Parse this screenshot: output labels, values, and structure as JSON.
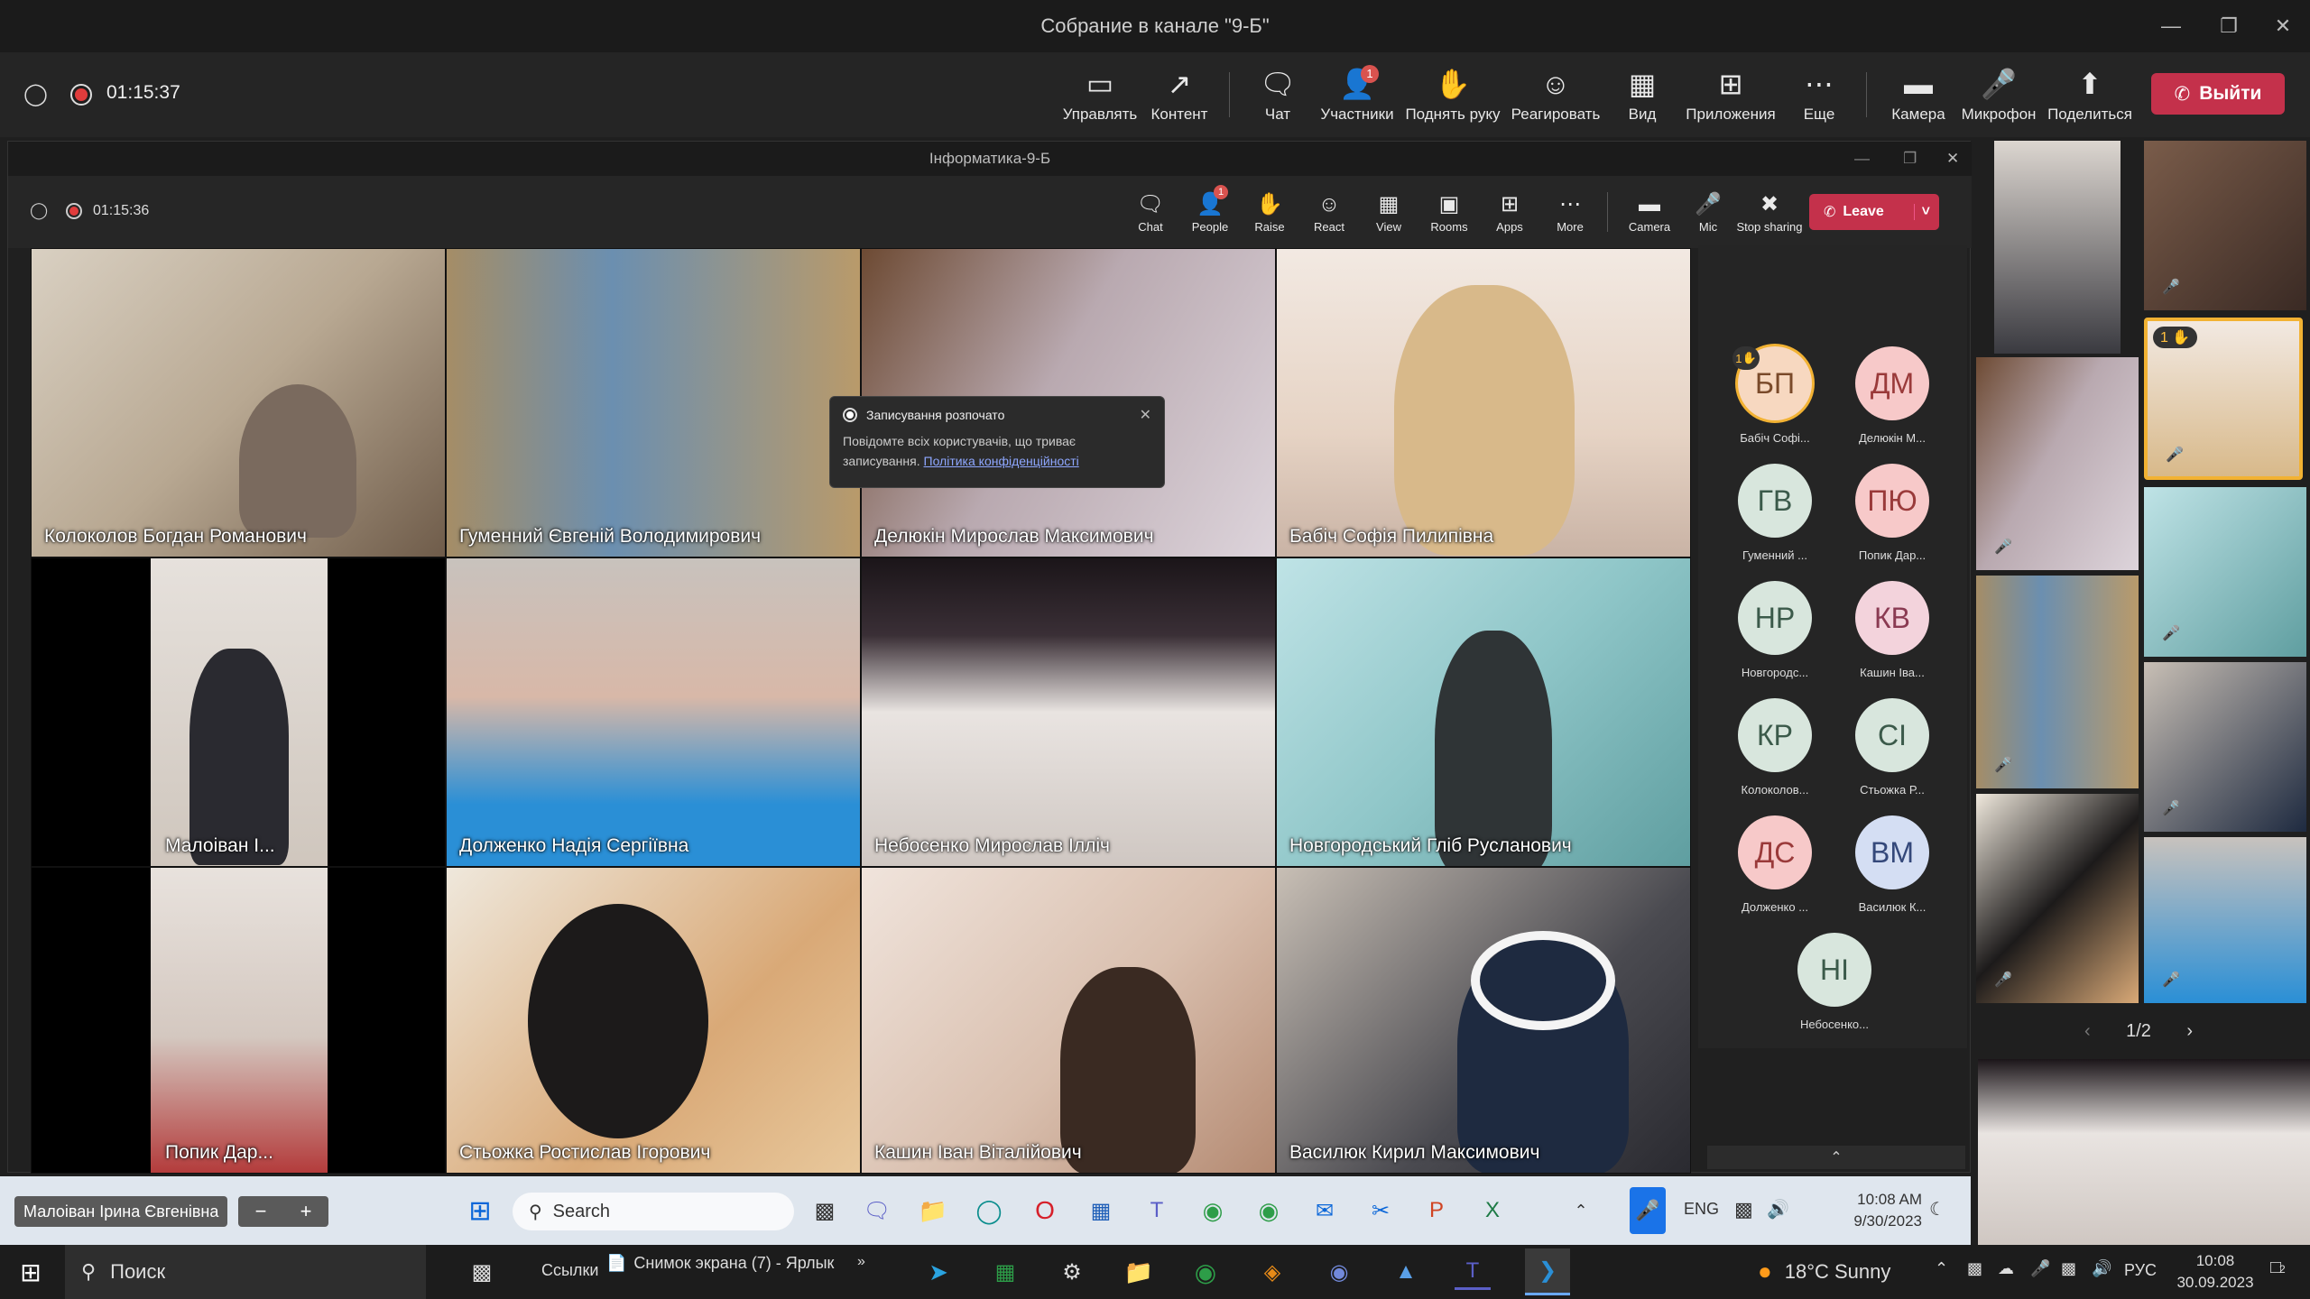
{
  "outer": {
    "window_title": "Собрание в канале \"9-Б\"",
    "timer": "01:15:37",
    "toolbar": [
      {
        "label": "Управлять",
        "icon": "share-screen-icon"
      },
      {
        "label": "Контент",
        "icon": "content-icon"
      },
      {
        "label": "Чат",
        "icon": "chat-icon"
      },
      {
        "label": "Участники",
        "icon": "people-icon",
        "badge": "1"
      },
      {
        "label": "Поднять руку",
        "icon": "raise-hand-icon"
      },
      {
        "label": "Реагировать",
        "icon": "react-icon"
      },
      {
        "label": "Вид",
        "icon": "view-icon"
      },
      {
        "label": "Приложения",
        "icon": "apps-icon"
      },
      {
        "label": "Еще",
        "icon": "more-icon"
      },
      {
        "label": "Камера",
        "icon": "camera-icon"
      },
      {
        "label": "Микрофон",
        "icon": "mic-off-icon"
      },
      {
        "label": "Поделиться",
        "icon": "share-icon"
      }
    ],
    "leave_label": "Выйти"
  },
  "inner": {
    "window_title": "Інформатика-9-Б",
    "timer": "01:15:36",
    "toolbar": [
      {
        "label": "Chat"
      },
      {
        "label": "People",
        "badge": "1"
      },
      {
        "label": "Raise"
      },
      {
        "label": "React"
      },
      {
        "label": "View"
      },
      {
        "label": "Rooms"
      },
      {
        "label": "Apps"
      },
      {
        "label": "More"
      },
      {
        "label": "Camera"
      },
      {
        "label": "Mic"
      },
      {
        "label": "Stop sharing"
      }
    ],
    "leave_label": "Leave",
    "notification": {
      "title": "Записування розпочато",
      "body": "Повідомте всіх користувачів, що триває записування.",
      "link": "Політика конфіденційності"
    },
    "tiles": [
      "Колоколов Богдан Романович",
      "Гуменний Євгеній Володимирович",
      "Делюкін Мирослав Максимович",
      "Бабіч Софія Пилипівна",
      "Малоіван І...",
      "Долженко Надія Сергіївна",
      "Небосенко Мирослав Ілліч",
      "Новгородський Гліб Русланович",
      "Попик Дар...",
      "Стьожка Ростислав Ігорович",
      "Кашин Іван Віталійович",
      "Василюк Кирил Максимович"
    ],
    "roster": [
      {
        "initials": "БП",
        "name": "Бабіч Софі...",
        "color": "#f7d8c0",
        "text": "#7a4a2a",
        "hand": "1"
      },
      {
        "initials": "ДМ",
        "name": "Делюкін М...",
        "color": "#f7c9c9",
        "text": "#9a3a3a"
      },
      {
        "initials": "ГВ",
        "name": "Гуменний ...",
        "color": "#d8e6dd",
        "text": "#3b5a4a"
      },
      {
        "initials": "ПЮ",
        "name": "Попик Дар...",
        "color": "#f7c9c9",
        "text": "#9a3a3a"
      },
      {
        "initials": "НР",
        "name": "Новгородс...",
        "color": "#d8e6dd",
        "text": "#3b5a4a"
      },
      {
        "initials": "КВ",
        "name": "Кашин Іва...",
        "color": "#f3d3dc",
        "text": "#8a3a52"
      },
      {
        "initials": "КР",
        "name": "Колоколов...",
        "color": "#d8e6dd",
        "text": "#3b5a4a"
      },
      {
        "initials": "СІ",
        "name": "Стьожка Р...",
        "color": "#d8e6dd",
        "text": "#3b5a4a"
      },
      {
        "initials": "ДС",
        "name": "Долженко ...",
        "color": "#f7c9c9",
        "text": "#9a3a3a"
      },
      {
        "initials": "ВМ",
        "name": "Василюк К...",
        "color": "#d4def3",
        "text": "#34487a"
      },
      {
        "initials": "НІ",
        "name": "Небосенко...",
        "color": "#d8e6dd",
        "text": "#3b5a4a"
      }
    ]
  },
  "right_strip": {
    "hand_badge": "1",
    "pager": "1/2"
  },
  "taskbar_inner": {
    "presenter": "Малоіван Ірина Євгенівна",
    "search": "Search",
    "lang": "ENG",
    "time": "10:08 AM",
    "date": "9/30/2023"
  },
  "taskbar_outer": {
    "search": "Поиск",
    "links": "Ссылки",
    "shortcut": "Снимок экрана (7) - Ярлык",
    "weather": "18°C  Sunny",
    "lang": "РУС",
    "time": "10:08",
    "date": "30.09.2023",
    "notif_count": "2"
  }
}
